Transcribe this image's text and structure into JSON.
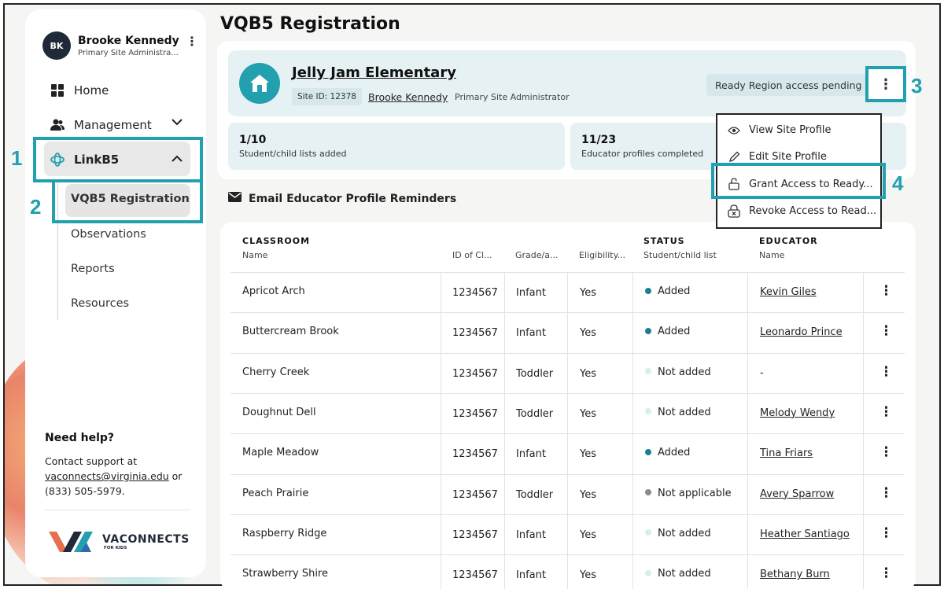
{
  "page": {
    "title": "VQB5 Registration"
  },
  "user": {
    "initials": "BK",
    "name": "Brooke Kennedy",
    "role": "Primary Site Administra..."
  },
  "nav": {
    "home": "Home",
    "management": "Management",
    "linkb5": "LinkB5",
    "sub": [
      "VQB5 Registration",
      "Observations",
      "Reports",
      "Resources"
    ]
  },
  "help": {
    "title": "Need help?",
    "line1": "Contact support at",
    "email": "vaconnects@virginia.edu",
    "or": " or",
    "phone": "(833) 505-5979."
  },
  "logo": {
    "main": "VACONNECTS",
    "sub": "FOR KIDS"
  },
  "site": {
    "name": "Jelly Jam Elementary",
    "id_label": "Site ID: 12378",
    "admin": "Brooke Kennedy",
    "admin_role": "Primary Site Administrator",
    "status": "Ready Region access pending"
  },
  "stats": [
    {
      "value": "1/10",
      "label": "Student/child lists added"
    },
    {
      "value": "11/23",
      "label": "Educator profiles completed"
    }
  ],
  "email_reminders": "Email Educator Profile Reminders",
  "menu": {
    "items": [
      "View Site Profile",
      "Edit Site Profile",
      "Grant Access to Ready...",
      "Revoke Access to Read..."
    ]
  },
  "annotations": [
    "1",
    "2",
    "3",
    "4"
  ],
  "table": {
    "headers": {
      "classroom": "CLASSROOM",
      "name": "Name",
      "id": "ID of Cl...",
      "grade": "Grade/a...",
      "eligibility": "Eligibility...",
      "status": "STATUS",
      "status_sub": "Student/child list",
      "educator": "EDUCATOR",
      "educator_sub": "Name"
    },
    "rows": [
      {
        "name": "Apricot Arch",
        "id": "1234567",
        "grade": "Infant",
        "elig": "Yes",
        "status": "Added",
        "educator": "Kevin Giles"
      },
      {
        "name": "Buttercream Brook",
        "id": "1234567",
        "grade": "Infant",
        "elig": "Yes",
        "status": "Added",
        "educator": "Leonardo Prince"
      },
      {
        "name": "Cherry Creek",
        "id": "1234567",
        "grade": "Toddler",
        "elig": "Yes",
        "status": "Not added",
        "educator": "-"
      },
      {
        "name": "Doughnut Dell",
        "id": "1234567",
        "grade": "Toddler",
        "elig": "Yes",
        "status": "Not added",
        "educator": "Melody Wendy"
      },
      {
        "name": "Maple Meadow",
        "id": "1234567",
        "grade": "Infant",
        "elig": "Yes",
        "status": "Added",
        "educator": "Tina Friars"
      },
      {
        "name": "Peach Prairie",
        "id": "1234567",
        "grade": "Toddler",
        "elig": "Yes",
        "status": "Not applicable",
        "educator": "Avery Sparrow"
      },
      {
        "name": "Raspberry Ridge",
        "id": "1234567",
        "grade": "Infant",
        "elig": "Yes",
        "status": "Not added",
        "educator": "Heather Santiago"
      },
      {
        "name": "Strawberry Shire",
        "id": "1234567",
        "grade": "Infant",
        "elig": "Yes",
        "status": "Not added",
        "educator": "Bethany Burn"
      }
    ]
  },
  "colors": {
    "accent": "#22a0b0",
    "added": "#1b7f93",
    "not_added": "#d9ecf0",
    "not_applicable": "#8a8a8a"
  }
}
